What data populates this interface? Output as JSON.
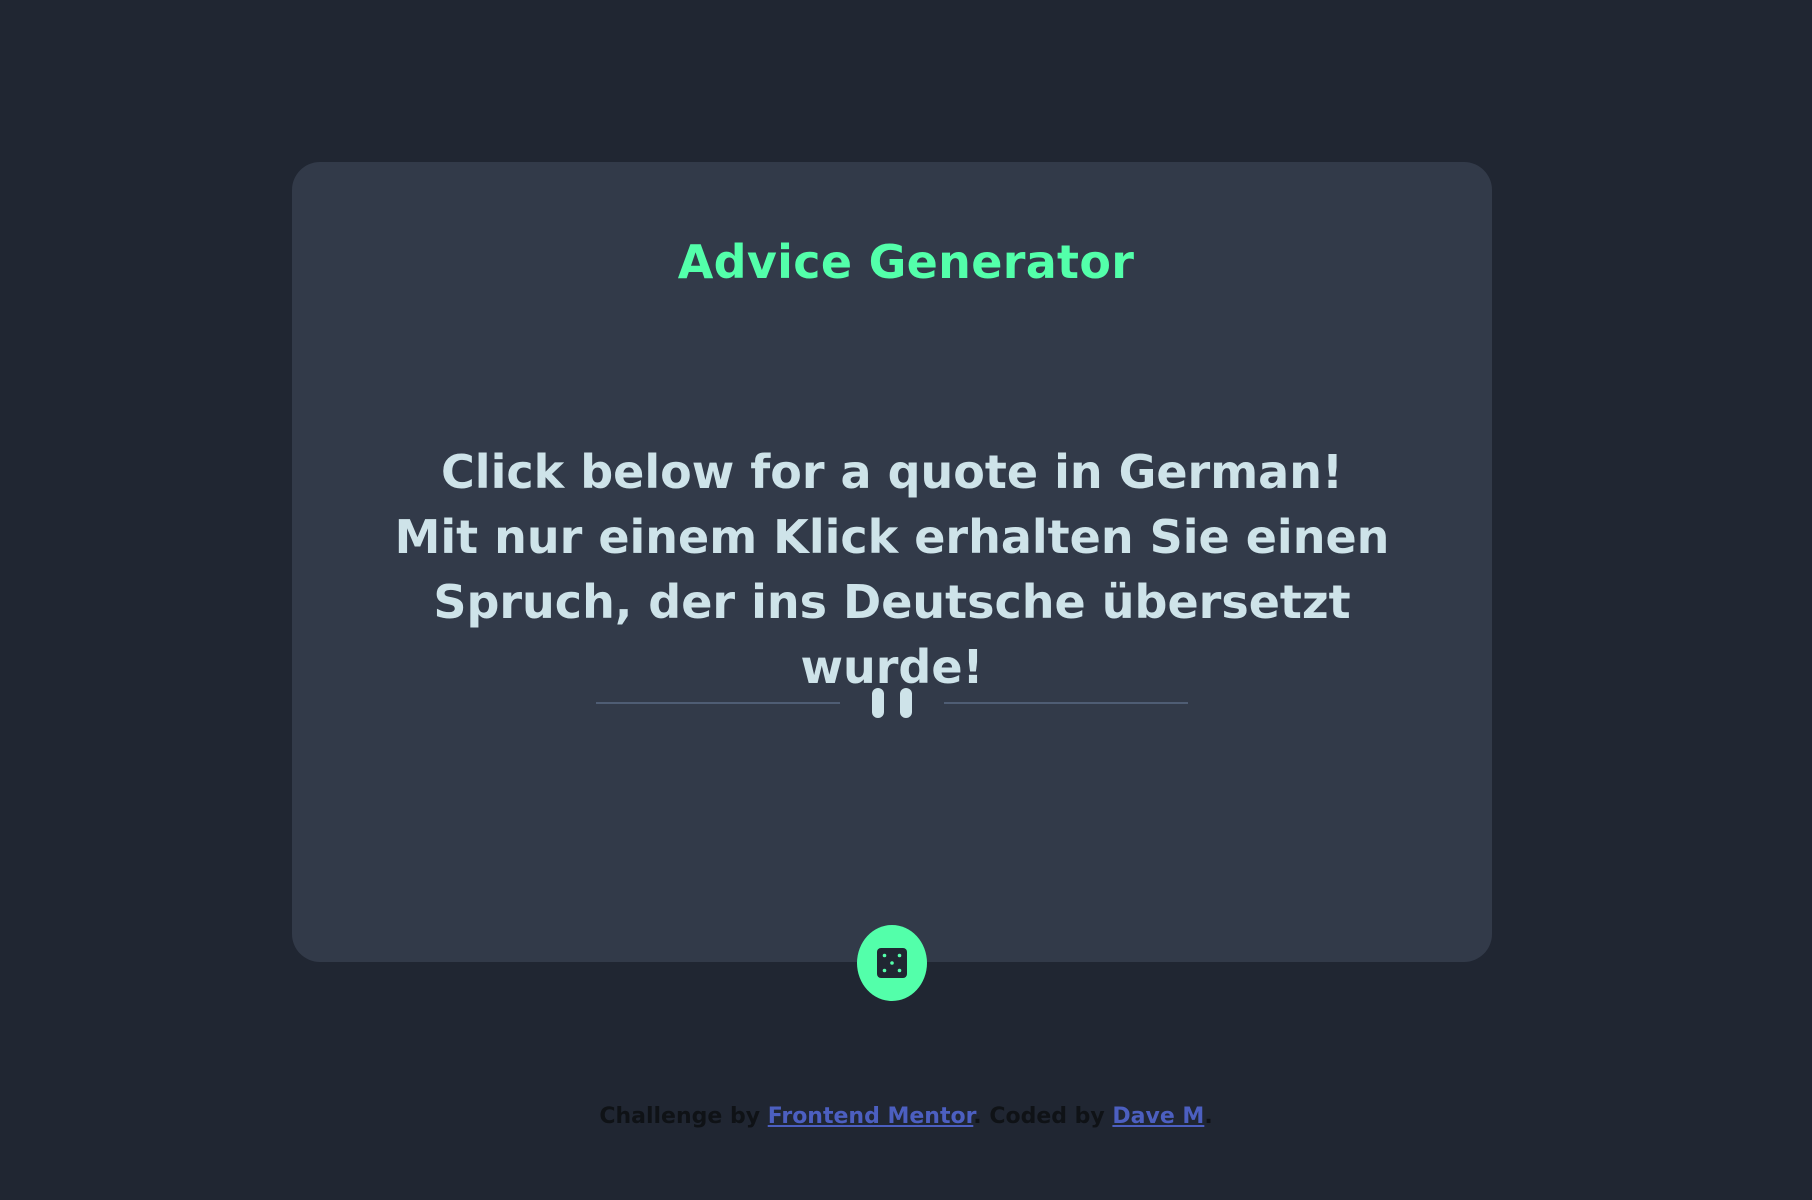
{
  "card": {
    "title": "Advice Generator",
    "quote_lines": [
      "Click below for a quote in German!",
      "Mit nur einem Klick erhalten Sie einen",
      "Spruch, der ins Deutsche übersetzt wurde!"
    ],
    "divider_icon": "pause-icon",
    "button_icon": "dice-icon"
  },
  "footer": {
    "prefix": "Challenge by ",
    "link1": "Frontend Mentor",
    "middle": ". Coded by ",
    "link2": "Dave M",
    "suffix": "."
  },
  "colors": {
    "background": "#202632",
    "card": "#323a49",
    "accent": "#53ffaa",
    "text": "#cee3e9",
    "divider": "#4f5d74",
    "link": "#4c5fc0"
  }
}
